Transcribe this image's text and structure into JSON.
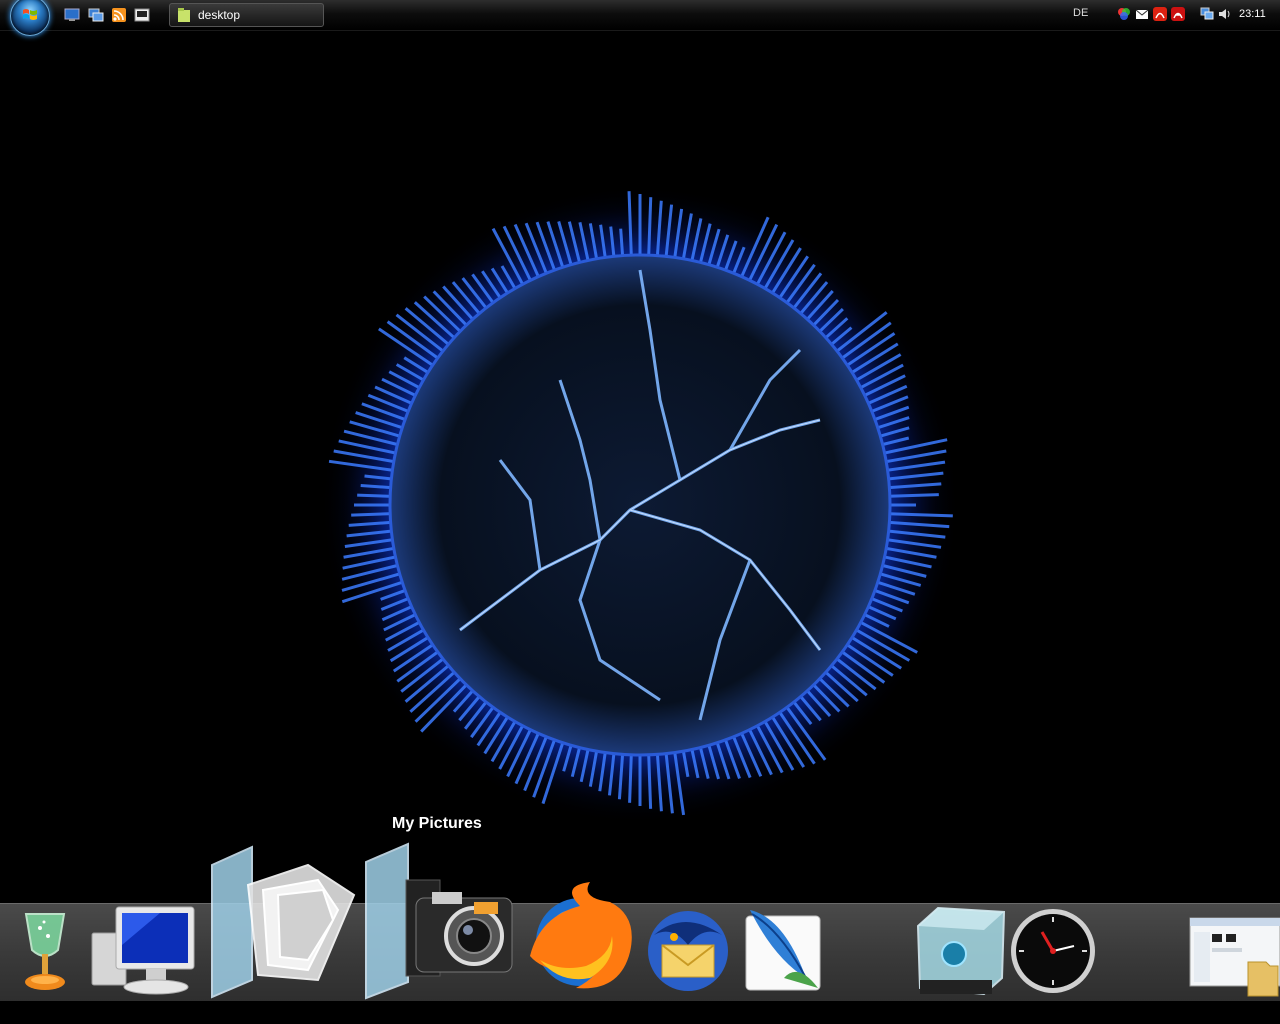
{
  "taskbar": {
    "start_button": "start-button",
    "quick_launch": [
      "show-desktop-icon",
      "switch-windows-icon",
      "rss-icon",
      "media-icon"
    ],
    "tasks": [
      {
        "label": "desktop"
      }
    ],
    "language": "DE",
    "clock": "23:11"
  },
  "dock": {
    "tooltip": "My Pictures",
    "items": [
      {
        "name": "trophy-icon"
      },
      {
        "name": "computer-icon"
      },
      {
        "name": "documents-stack-icon"
      },
      {
        "name": "my-pictures-icon"
      },
      {
        "name": "firefox-icon"
      },
      {
        "name": "thunderbird-icon"
      },
      {
        "name": "feather-icon"
      },
      {
        "name": "recycle-bin-icon"
      },
      {
        "name": "clock-icon"
      },
      {
        "name": "explorer-window-thumbnail"
      }
    ]
  },
  "colors": {
    "background": "#000000",
    "glow": "#2a6bff",
    "dock": "#3a3a3a"
  }
}
